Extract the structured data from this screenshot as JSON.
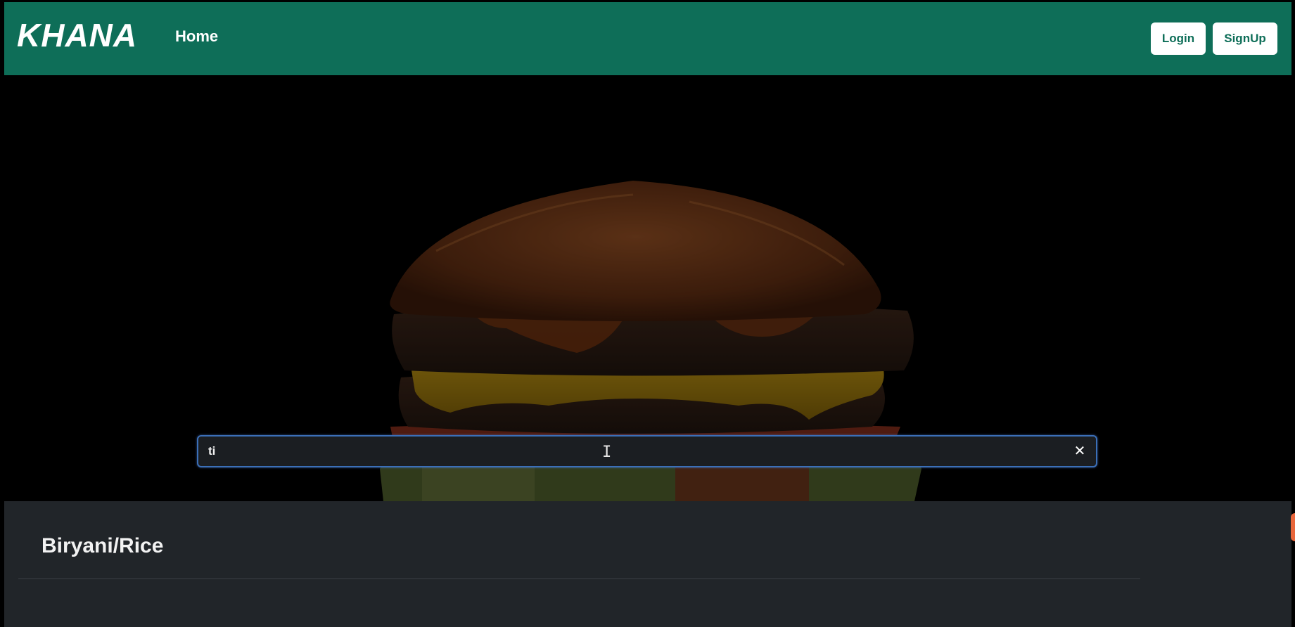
{
  "navbar": {
    "brand": "KHANA",
    "links": [
      {
        "label": "Home"
      }
    ],
    "buttons": {
      "login_label": "Login",
      "signup_label": "SignUp"
    }
  },
  "hero": {
    "image": "burger-image",
    "search": {
      "value": "ti",
      "clear_icon": "close-icon"
    }
  },
  "categories": [
    {
      "title": "Biryani/Rice"
    }
  ],
  "colors": {
    "navbar": "#0e6e58",
    "category_bg": "#212529",
    "search_border": "#3b6fb8"
  }
}
